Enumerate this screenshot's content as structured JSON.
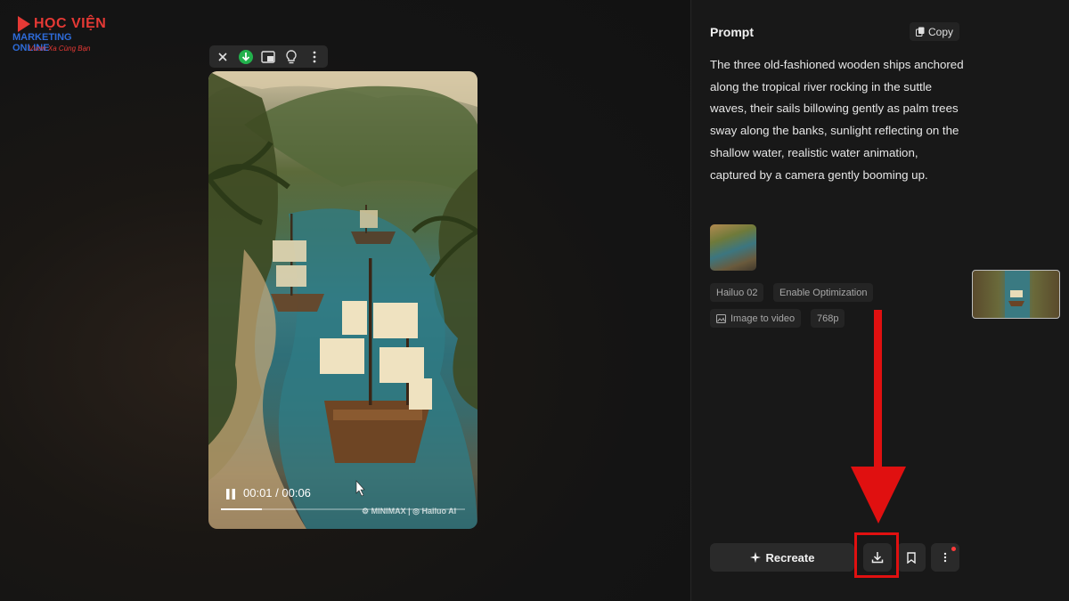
{
  "logo": {
    "line1": "HỌC VIỆN",
    "line2": "MARKETING ONLINE",
    "line3": "Vươn Xa Cùng Bạn"
  },
  "toolbar": {
    "icons": [
      "close-icon",
      "download-circle-icon",
      "picture-in-picture-icon",
      "lightbulb-icon",
      "more-vertical-icon"
    ]
  },
  "video": {
    "time": "00:01 / 00:06",
    "progress": 0.167,
    "watermark": "⚙ MINIMAX | ◎ Hailuo AI"
  },
  "prompt": {
    "title": "Prompt",
    "copy_label": "Copy",
    "text": "The three old-fashioned wooden ships anchored along the tropical river rocking in the suttle waves, their sails billowing gently as palm trees sway along the banks, sunlight reflecting on the shallow water, realistic water animation, captured by a camera gently booming up."
  },
  "tags": {
    "model": "Hailuo 02",
    "optimization": "Enable Optimization",
    "mode": "Image to video",
    "resolution": "768p"
  },
  "actions": {
    "recreate_label": "Recreate"
  },
  "colors": {
    "highlight": "#e01010",
    "accent_green": "#22b14c"
  }
}
